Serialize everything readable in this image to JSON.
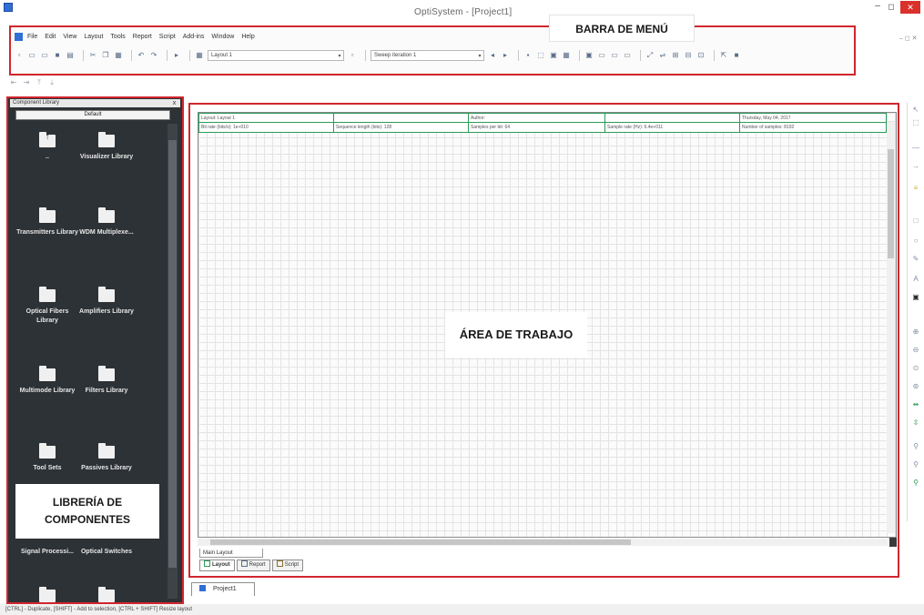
{
  "window": {
    "title": "OptiSystem - [Project1]",
    "controls": {
      "minimize": "–",
      "maximize": "◻",
      "close": "✕"
    }
  },
  "annotations": {
    "menu_bar": "BARRA DE MENÚ",
    "work_area": "ÁREA DE TRABAJO",
    "library_line1": "LIBRERÍA DE",
    "library_line2": "COMPONENTES"
  },
  "menu": {
    "items": [
      "File",
      "Edit",
      "View",
      "Layout",
      "Tools",
      "Report",
      "Script",
      "Add-ins",
      "Window",
      "Help"
    ]
  },
  "toolbar": {
    "layout_combo": "Layout 1",
    "sweep_combo": "Sweep iteration 1"
  },
  "library": {
    "title": "Component Library",
    "close": "x",
    "selected": "Default",
    "items": [
      {
        "label": "..",
        "icon": "folder-up-icon"
      },
      {
        "label": "Visualizer Library",
        "icon": "folder-icon"
      },
      {
        "label": "Transmitters Library",
        "icon": "folder-icon"
      },
      {
        "label": "WDM Multiplexe...",
        "icon": "folder-icon"
      },
      {
        "label": "Optical Fibers Library",
        "icon": "folder-icon"
      },
      {
        "label": "Amplifiers Library",
        "icon": "folder-icon"
      },
      {
        "label": "Multimode Library",
        "icon": "folder-icon"
      },
      {
        "label": "Filters Library",
        "icon": "folder-icon"
      },
      {
        "label": "Tool Sets",
        "icon": "folder-icon"
      },
      {
        "label": "Passives Library",
        "icon": "folder-icon"
      },
      {
        "label": "Signal Processi...",
        "icon": "folder-icon"
      },
      {
        "label": "Optical Switches",
        "icon": "folder-icon"
      }
    ]
  },
  "layout_header": {
    "row1": [
      "Layout: Layout 1",
      "",
      "Author:",
      "",
      "Thursday, May 04, 2017"
    ],
    "row2": [
      "Bit rate (bits/s): 1e+010",
      "Sequence length (bits): 128",
      "Samples per bit: 64",
      "Sample rate (Hz): 6.4e+011",
      "Number of samples: 8192"
    ]
  },
  "work_tabs": {
    "main_layout": "Main Layout",
    "view_tabs": [
      "Layout",
      "Report",
      "Script"
    ]
  },
  "doc_tab": "Project1",
  "status_bar": "[CTRL] - Duplicate, [SHIFT] - Add to selection, [CTRL + SHIFT] Resize layout",
  "colors": {
    "highlight_border": "#d1262e",
    "library_bg": "#2d3236",
    "header_green": "#2a9b57",
    "close_button": "#d9312c"
  }
}
